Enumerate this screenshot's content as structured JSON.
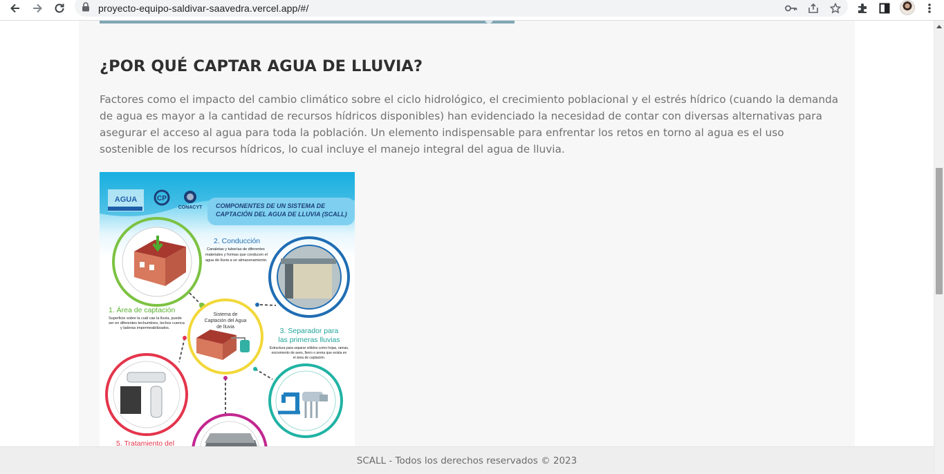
{
  "browser": {
    "url": "proyecto-equipo-saldivar-saavedra.vercel.app/#/",
    "icons": [
      "back-icon",
      "forward-icon",
      "reload-icon",
      "lock-icon",
      "key-icon",
      "share-icon",
      "star-icon",
      "extensions-icon",
      "side-panel-icon",
      "avatar",
      "menu-icon"
    ]
  },
  "section": {
    "heading": "¿POR QUÉ CAPTAR AGUA DE LLUVIA?",
    "paragraph": "Factores como el impacto del cambio climático sobre el ciclo hidrológico, el crecimiento poblacional y el estrés hídrico (cuando la demanda de agua es mayor a la cantidad de recursos hídricos disponibles) han evidenciado la necesidad de contar con diversas alternativas para asegurar el acceso al agua para toda la población. Un elemento indispensable para enfrentar los retos en torno al agua es el uso sostenible de los recursos hídricos, lo cual incluye el manejo integral del agua de lluvia."
  },
  "infographic": {
    "logo_1": "AGUA",
    "logo_2": "CP",
    "logo_3": "CONACYT",
    "banner_line1": "COMPONENTES DE UN SISTEMA DE",
    "banner_line2": "CAPTACIÓN DEL AGUA DE LLUVIA (SCALL)",
    "c1_title": "1. Área de captación",
    "c1_desc": [
      "Superficie sobre la cuál cae la lluvia, puede",
      "ser en diferentes techumbres, techos cuenca",
      "y laderas impermeabilizados."
    ],
    "c2_title": "2. Conducción",
    "c2_desc": [
      "Canaletas y tuberías de diferentes",
      "materiales y formas que conducen el",
      "agua de lluvia a un almacenamiento."
    ],
    "center_text": [
      "Sistema de",
      "Captación del Agua",
      "de lluvia"
    ],
    "c3_title": [
      "3. Separador para",
      "las primeras lluvias"
    ],
    "c3_desc": [
      "Estructura para separar sólidos como hojas, ramas,",
      "excremento de aves, fierro o arena que exista en",
      "el área de captación."
    ],
    "c5_title": "5. Tratamiento del",
    "colors": {
      "green": "#7cc242",
      "blue": "#1f6db3",
      "yellow": "#f2d83a",
      "teal": "#20b3a4",
      "red": "#e4354c",
      "magenta": "#c2278f"
    }
  },
  "footer": {
    "text": "SCALL - Todos los derechos reservados © 2023"
  }
}
